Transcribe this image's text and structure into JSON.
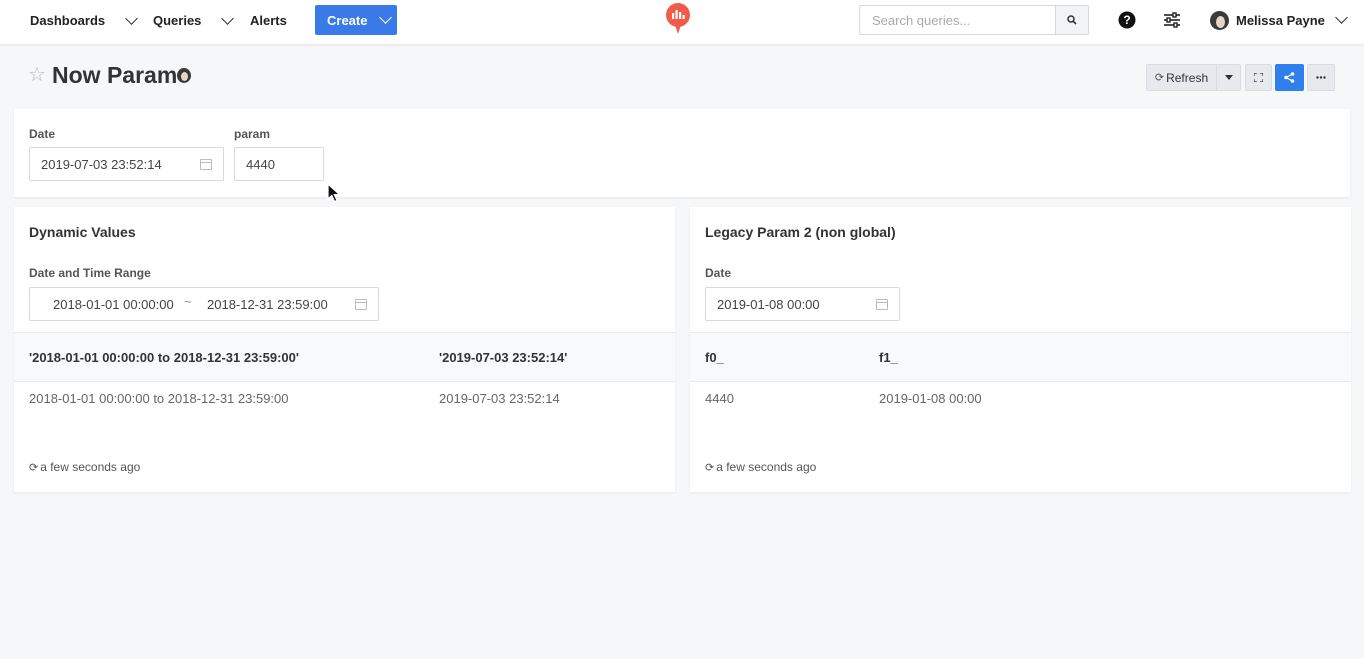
{
  "nav": {
    "dashboards": "Dashboards",
    "queries": "Queries",
    "alerts": "Alerts",
    "create": "Create",
    "search_placeholder": "Search queries...",
    "user_name": "Melissa Payne"
  },
  "page": {
    "title": "Now Param",
    "refresh_label": "Refresh"
  },
  "global_params": {
    "date_label": "Date",
    "date_value": "2019-07-03 23:52:14",
    "param_label": "param",
    "param_value": "4440"
  },
  "widgets": [
    {
      "title": "Dynamic Values",
      "param_label": "Date and Time Range",
      "range_start": "2018-01-01 00:00:00",
      "range_sep": "~",
      "range_end": "2018-12-31 23:59:00",
      "columns": [
        "'2018-01-01 00:00:00 to 2018-12-31 23:59:00'",
        "'2019-07-03 23:52:14'"
      ],
      "rows": [
        [
          "2018-01-01 00:00:00 to 2018-12-31 23:59:00",
          "2019-07-03 23:52:14"
        ]
      ],
      "updated": "a few seconds ago"
    },
    {
      "title": "Legacy Param 2 (non global)",
      "param_label": "Date",
      "param_value": "2019-01-08 00:00",
      "columns": [
        "f0_",
        "f1_"
      ],
      "rows": [
        [
          "4440",
          "2019-01-08 00:00"
        ]
      ],
      "updated": "a few seconds ago"
    }
  ],
  "colors": {
    "primary": "#3a7ae8",
    "logo": "#f25a4a",
    "background": "#f6f7f9"
  }
}
